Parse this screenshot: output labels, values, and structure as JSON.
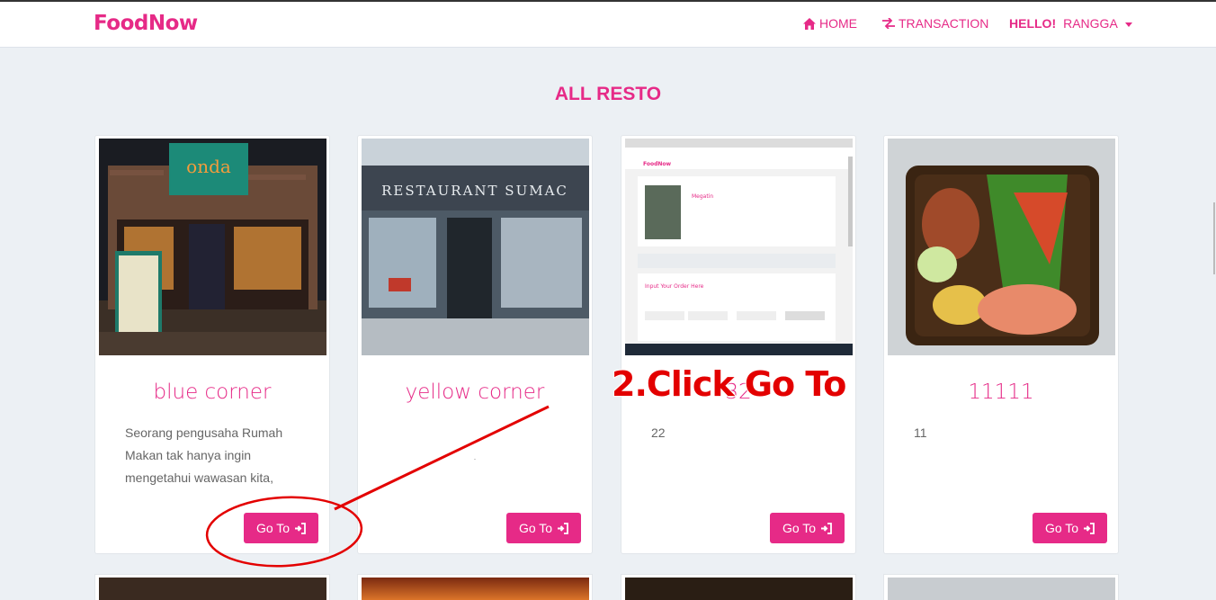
{
  "brand": "FoodNow",
  "nav": {
    "home": "HOME",
    "transaction": "TRANSACTION",
    "greeting": "HELLO!",
    "user": "RANGGA"
  },
  "page_title": "ALL RESTO",
  "cards": [
    {
      "name": "blue corner",
      "desc": "Seorang pengusaha Rumah Makan tak hanya ingin mengetahui wawasan kita,",
      "button": "Go To"
    },
    {
      "name": "yellow corner",
      "desc": ".",
      "button": "Go To"
    },
    {
      "name": "32",
      "desc": "22",
      "button": "Go To"
    },
    {
      "name": "11111",
      "desc": "11",
      "button": "Go To"
    }
  ],
  "thumbnails": {
    "card1_sign": "onda",
    "card2_sign": "RESTAURANT SUMAC",
    "card3_brand": "FoodNow",
    "card3_title": "Megatin",
    "card3_order": "Input Your Order Here"
  },
  "annotation": "2.Click Go To",
  "colors": {
    "accent": "#e62a87",
    "annotation": "#e30000"
  }
}
